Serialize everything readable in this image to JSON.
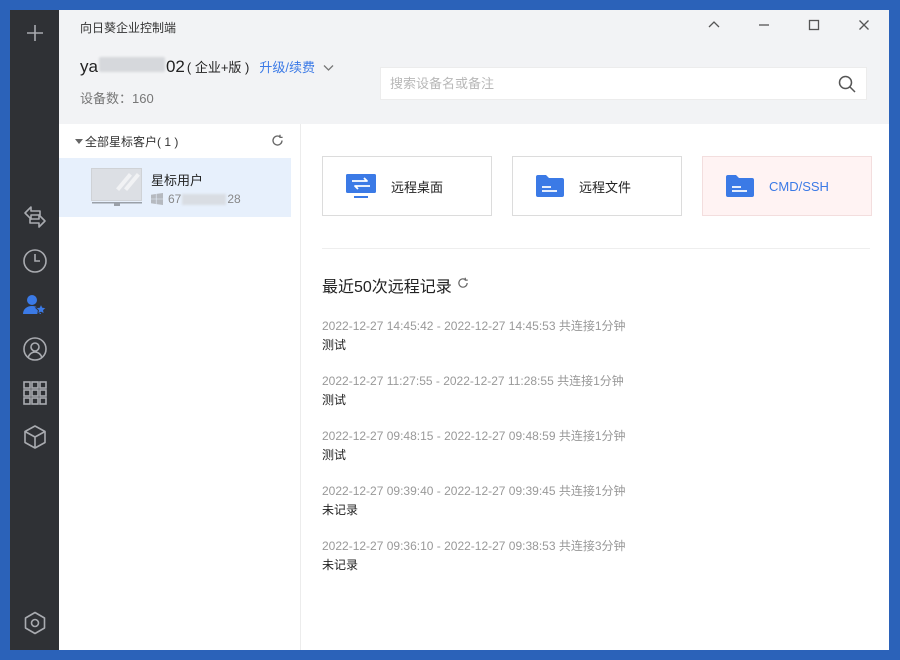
{
  "app": {
    "title": "向日葵企业控制端"
  },
  "account": {
    "name_prefix": "ya",
    "name_suffix": "02",
    "edition": "( 企业+版 )",
    "upgrade_label": "升级/续费",
    "device_count": "设备数：160"
  },
  "search": {
    "placeholder": "搜索设备名或备注"
  },
  "group": {
    "label": "全部星标客户( 1 )"
  },
  "device": {
    "name": "星标用户",
    "id_prefix": "67",
    "id_suffix": "28"
  },
  "actions": {
    "remote_desktop": "远程桌面",
    "remote_file": "远程文件",
    "cmd_ssh": "CMD/SSH"
  },
  "history": {
    "title": "最近50次远程记录",
    "records": [
      {
        "time": "2022-12-27 14:45:42 - 2022-12-27 14:45:53 共连接1分钟",
        "note": "测试"
      },
      {
        "time": "2022-12-27 11:27:55 - 2022-12-27 11:28:55 共连接1分钟",
        "note": "测试"
      },
      {
        "time": "2022-12-27 09:48:15 - 2022-12-27 09:48:59 共连接1分钟",
        "note": "测试"
      },
      {
        "time": "2022-12-27 09:39:40 - 2022-12-27 09:39:45 共连接1分钟",
        "note": "未记录"
      },
      {
        "time": "2022-12-27 09:36:10 - 2022-12-27 09:38:53 共连接3分钟",
        "note": "未记录"
      }
    ]
  },
  "colors": {
    "accent": "#3b7ae6",
    "sidebar": "#2f3135",
    "header": "#f2f3f5",
    "selected_row": "#e7f0fc",
    "frame": "#2b62b9"
  },
  "icons": {
    "sidebar": [
      "plus-icon",
      "swap-icon",
      "clock-icon",
      "star-user-icon",
      "location-icon",
      "apps-grid-icon",
      "cube-icon",
      "settings-hex-icon"
    ],
    "window_controls": [
      "chevron-up-icon",
      "minimize-icon",
      "maximize-icon",
      "close-icon"
    ]
  }
}
